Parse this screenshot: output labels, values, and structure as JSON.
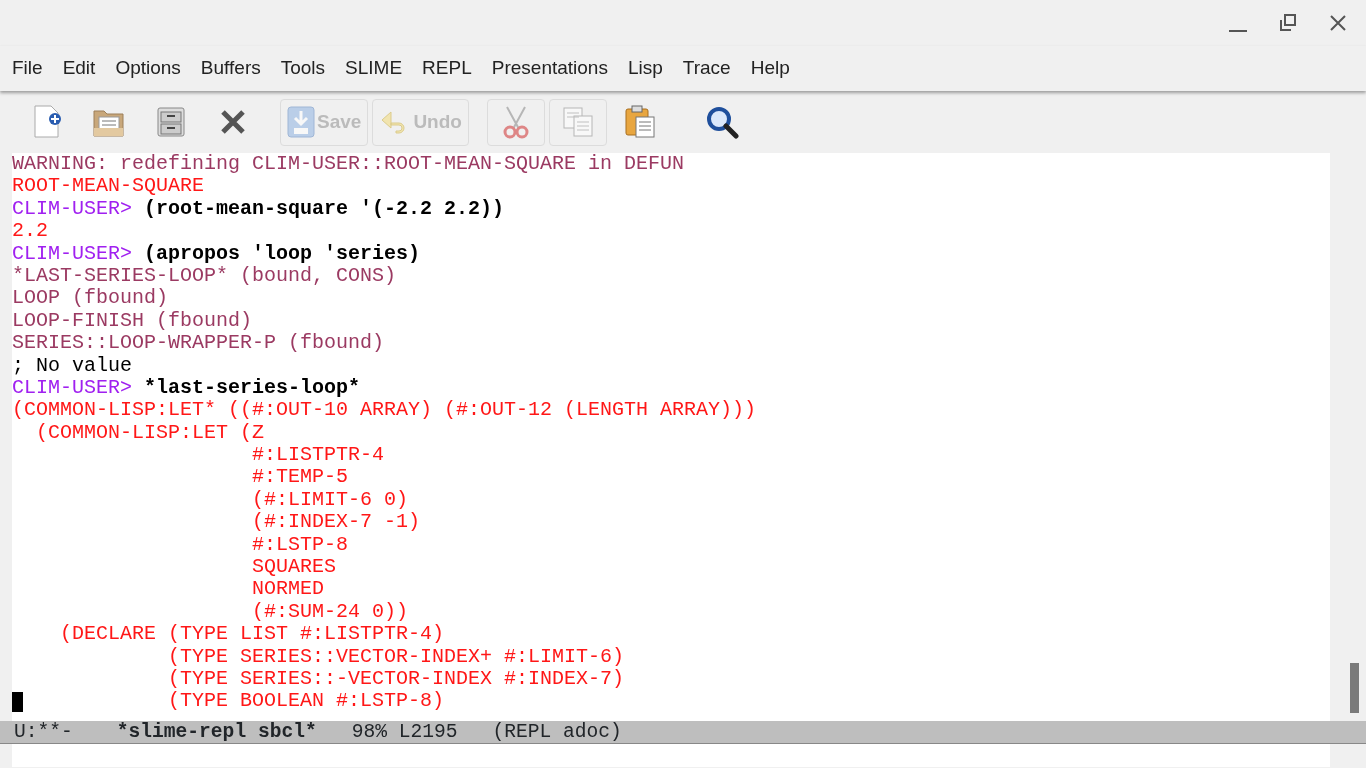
{
  "menu": [
    "File",
    "Edit",
    "Options",
    "Buffers",
    "Tools",
    "SLIME",
    "REPL",
    "Presentations",
    "Lisp",
    "Trace",
    "Help"
  ],
  "toolbar": [
    {
      "kind": "icon",
      "disabled": false
    },
    {
      "kind": "icon",
      "disabled": false
    },
    {
      "kind": "icon",
      "disabled": false
    },
    {
      "kind": "icon",
      "disabled": false
    },
    {
      "kind": "labeled",
      "label": "Save",
      "disabled": true
    },
    {
      "kind": "labeled",
      "label": "Undo",
      "disabled": true
    },
    {
      "kind": "icon",
      "disabled": true
    },
    {
      "kind": "icon",
      "disabled": true
    },
    {
      "kind": "icon",
      "disabled": false
    },
    {
      "kind": "icon",
      "disabled": false
    }
  ],
  "lines": [
    {
      "cursor": false,
      "segments": [
        {
          "kind": "warning",
          "text": "WARNING: redefining CLIM-USER::ROOT-MEAN-SQUARE in DEFUN"
        }
      ]
    },
    {
      "cursor": false,
      "segments": [
        {
          "kind": "result",
          "text": "ROOT-MEAN-SQUARE"
        }
      ]
    },
    {
      "cursor": false,
      "segments": [
        {
          "kind": "prompt",
          "text": "CLIM-USER>"
        },
        {
          "kind": "input",
          "text": "(root-mean-square '(-2.2 2.2))"
        }
      ]
    },
    {
      "cursor": false,
      "segments": [
        {
          "kind": "result",
          "text": "2.2"
        }
      ]
    },
    {
      "cursor": false,
      "segments": [
        {
          "kind": "prompt",
          "text": "CLIM-USER>"
        },
        {
          "kind": "input",
          "text": "(apropos 'loop 'series)"
        }
      ]
    },
    {
      "cursor": false,
      "segments": [
        {
          "kind": "warning",
          "text": "*LAST-SERIES-LOOP* (bound, CONS)"
        }
      ]
    },
    {
      "cursor": false,
      "segments": [
        {
          "kind": "warning",
          "text": "LOOP (fbound)"
        }
      ]
    },
    {
      "cursor": false,
      "segments": [
        {
          "kind": "warning",
          "text": "LOOP-FINISH (fbound)"
        }
      ]
    },
    {
      "cursor": false,
      "segments": [
        {
          "kind": "warning",
          "text": "SERIES::LOOP-WRAPPER-P (fbound)"
        }
      ]
    },
    {
      "cursor": false,
      "segments": [
        {
          "kind": "output",
          "text": "; No value"
        }
      ]
    },
    {
      "cursor": false,
      "segments": [
        {
          "kind": "prompt",
          "text": "CLIM-USER>"
        },
        {
          "kind": "input",
          "text": "*last-series-loop*"
        }
      ]
    },
    {
      "cursor": false,
      "segments": [
        {
          "kind": "result",
          "text": "(COMMON-LISP:LET* ((#:OUT-10 ARRAY) (#:OUT-12 (LENGTH ARRAY)))"
        }
      ]
    },
    {
      "cursor": false,
      "segments": [
        {
          "kind": "result",
          "text": "  (COMMON-LISP:LET (Z"
        }
      ]
    },
    {
      "cursor": false,
      "segments": [
        {
          "kind": "result",
          "text": "                    #:LISTPTR-4"
        }
      ]
    },
    {
      "cursor": false,
      "segments": [
        {
          "kind": "result",
          "text": "                    #:TEMP-5"
        }
      ]
    },
    {
      "cursor": false,
      "segments": [
        {
          "kind": "result",
          "text": "                    (#:LIMIT-6 0)"
        }
      ]
    },
    {
      "cursor": false,
      "segments": [
        {
          "kind": "result",
          "text": "                    (#:INDEX-7 -1)"
        }
      ]
    },
    {
      "cursor": false,
      "segments": [
        {
          "kind": "result",
          "text": "                    #:LSTP-8"
        }
      ]
    },
    {
      "cursor": false,
      "segments": [
        {
          "kind": "result",
          "text": "                    SQUARES"
        }
      ]
    },
    {
      "cursor": false,
      "segments": [
        {
          "kind": "result",
          "text": "                    NORMED"
        }
      ]
    },
    {
      "cursor": false,
      "segments": [
        {
          "kind": "result",
          "text": "                    (#:SUM-24 0))"
        }
      ]
    },
    {
      "cursor": false,
      "segments": [
        {
          "kind": "result",
          "text": "    (DECLARE (TYPE LIST #:LISTPTR-4)"
        }
      ]
    },
    {
      "cursor": false,
      "segments": [
        {
          "kind": "result",
          "text": "             (TYPE SERIES::VECTOR-INDEX+ #:LIMIT-6)"
        }
      ]
    },
    {
      "cursor": false,
      "segments": [
        {
          "kind": "result",
          "text": "             (TYPE SERIES::-VECTOR-INDEX #:INDEX-7)"
        }
      ]
    },
    {
      "cursor": true,
      "segments": [
        {
          "kind": "result",
          "text": "             (TYPE BOOLEAN #:LSTP-8)"
        }
      ]
    }
  ],
  "modeline": [
    {
      "text": "U:**-",
      "bold": false
    },
    {
      "text": "*slime-repl sbcl*",
      "bold": true
    },
    {
      "text": "98% L2195",
      "bold": false
    },
    {
      "text": "(REPL adoc)",
      "bold": false
    }
  ]
}
